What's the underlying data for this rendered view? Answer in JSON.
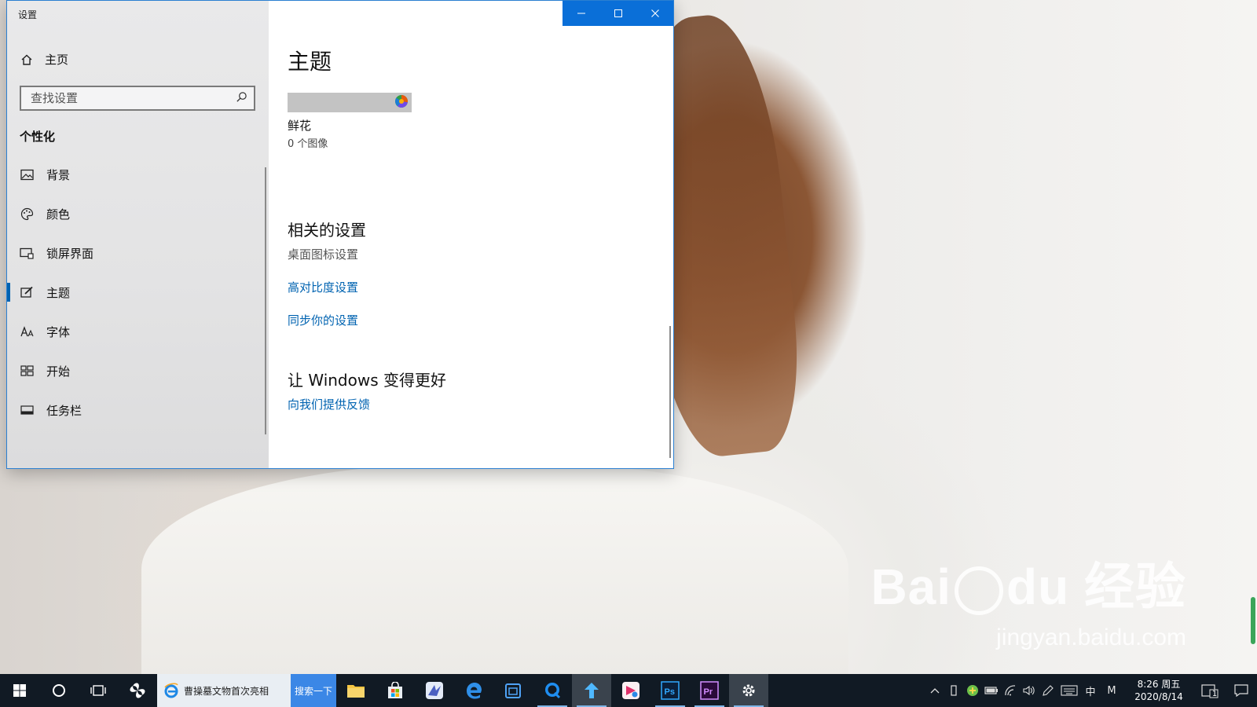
{
  "window": {
    "title": "设置",
    "home_label": "主页",
    "search_placeholder": "查找设置",
    "section_title": "个性化",
    "nav": [
      {
        "label": "背景",
        "icon": "image-icon"
      },
      {
        "label": "颜色",
        "icon": "palette-icon"
      },
      {
        "label": "锁屏界面",
        "icon": "lock-screen-icon"
      },
      {
        "label": "主题",
        "icon": "theme-brush-icon",
        "active": true
      },
      {
        "label": "字体",
        "icon": "font-icon"
      },
      {
        "label": "开始",
        "icon": "start-grid-icon"
      },
      {
        "label": "任务栏",
        "icon": "taskbar-icon"
      }
    ],
    "controls": {
      "minimize": "minimize-icon",
      "maximize": "maximize-icon",
      "close": "close-icon"
    }
  },
  "content": {
    "page_title": "主题",
    "theme": {
      "name": "鲜花",
      "count": "0 个图像"
    },
    "related_title": "相关的设置",
    "desktop_icon_setting": "桌面图标设置",
    "high_contrast_link": "高对比度设置",
    "sync_link": "同步你的设置",
    "better_title": "让 Windows 变得更好",
    "feedback_link": "向我们提供反馈"
  },
  "taskbar": {
    "browser_task_label": "曹操墓文物首次亮相",
    "search_button": "搜索一下",
    "tray_lang": "中",
    "tray_ime": "M",
    "clock_time": "8:26 周五",
    "clock_date": "2020/8/14",
    "notification_count": "1"
  },
  "watermark": {
    "main_left": "Bai",
    "main_right": "du",
    "main_cn": "经验",
    "sub": "jingyan.baidu.com"
  },
  "colors": {
    "accent": "#0063b1",
    "titlebar": "#0a6fd8",
    "taskbar": "#111a24"
  }
}
